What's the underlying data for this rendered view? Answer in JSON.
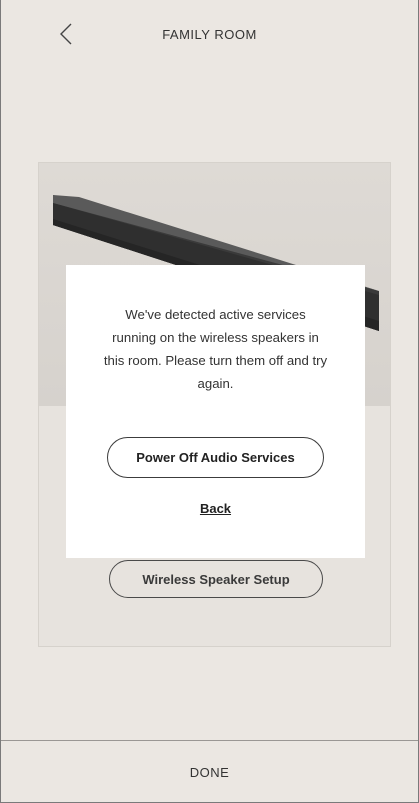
{
  "header": {
    "back_icon": "chevron-left-icon",
    "title": "FAMILY ROOM"
  },
  "card": {
    "product_image": "soundbar-product-image",
    "setup_button_label": "Wireless Speaker Setup"
  },
  "modal": {
    "message": "We've detected active services running on the wireless speakers in this room. Please turn them off and try again.",
    "primary_button_label": "Power Off Audio Services",
    "back_link_label": "Back"
  },
  "footer": {
    "done_label": "DONE"
  },
  "colors": {
    "background": "#ebe7e2",
    "modal_background": "#ffffff",
    "text": "#333333"
  }
}
